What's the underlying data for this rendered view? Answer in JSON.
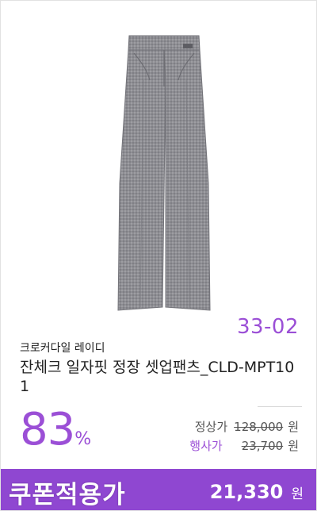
{
  "product": {
    "image_alt": "grey check pants",
    "code": "33-02",
    "brand": "크로커다일 레이디",
    "title": "잔체크 일자핏 정장 셋업팬츠_CLD-MPT101",
    "discount_value": "83",
    "discount_unit": "%"
  },
  "prices": {
    "regular_label": "정상가",
    "regular_amount": "128,000",
    "regular_unit": "원",
    "event_label": "행사가",
    "event_amount": "23,700",
    "event_unit": "원"
  },
  "coupon": {
    "label": "쿠폰적용가",
    "amount": "21,330",
    "unit": "원"
  },
  "colors": {
    "accent": "#9b4fd6",
    "coupon_bar": "#8f47d1",
    "pants": "#8d8d92"
  }
}
